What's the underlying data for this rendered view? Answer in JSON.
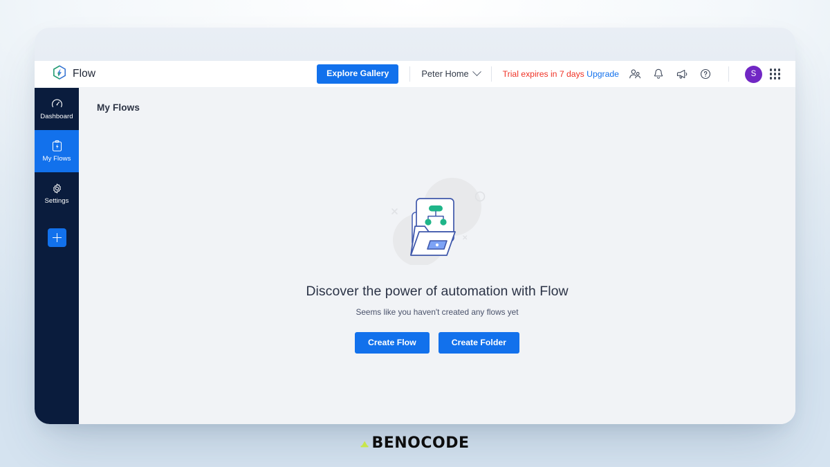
{
  "app": {
    "brand_name": "Flow",
    "brand_icon": "flow-hex-bolt-logo"
  },
  "topbar": {
    "explore_gallery_label": "Explore Gallery",
    "workspace_name": "Peter Home",
    "workspace_chevron_icon": "chevron-down-icon",
    "trial_text": "Trial expires in 7 days",
    "upgrade_label": "Upgrade",
    "icons": [
      {
        "name": "invite-users-icon",
        "glyph": "people-add"
      },
      {
        "name": "notifications-bell-icon",
        "glyph": "bell"
      },
      {
        "name": "announcements-megaphone-icon",
        "glyph": "megaphone"
      },
      {
        "name": "help-icon",
        "glyph": "question-circle"
      }
    ],
    "avatar_initial": "S",
    "avatar_color": "#7127c4",
    "apps_grid_icon": "apps-grid-icon",
    "accent_color": "#1271ec",
    "trial_color": "#ef3124"
  },
  "sidebar": {
    "background_color": "#0a1c3d",
    "active_color": "#1271ec",
    "items": [
      {
        "label": "Dashboard",
        "icon": "dashboard-gauge-icon",
        "active": false
      },
      {
        "label": "My Flows",
        "icon": "clipboard-bolt-icon",
        "active": true
      },
      {
        "label": "Settings",
        "icon": "gear-icon",
        "active": false
      }
    ],
    "add_button_icon": "plus-icon"
  },
  "content": {
    "page_title": "My Flows",
    "empty_state": {
      "illustration": "folder-with-flowchart-card-illustration",
      "heading": "Discover the power of automation with Flow",
      "subtext": "Seems like you haven't created any flows yet",
      "primary_button": "Create Flow",
      "secondary_button": "Create Folder"
    }
  },
  "footer": {
    "wordmark": "BENOCODE",
    "wordmark_accent_icon": "benocode-accent-mark",
    "accent_color": "#c8e64a"
  }
}
